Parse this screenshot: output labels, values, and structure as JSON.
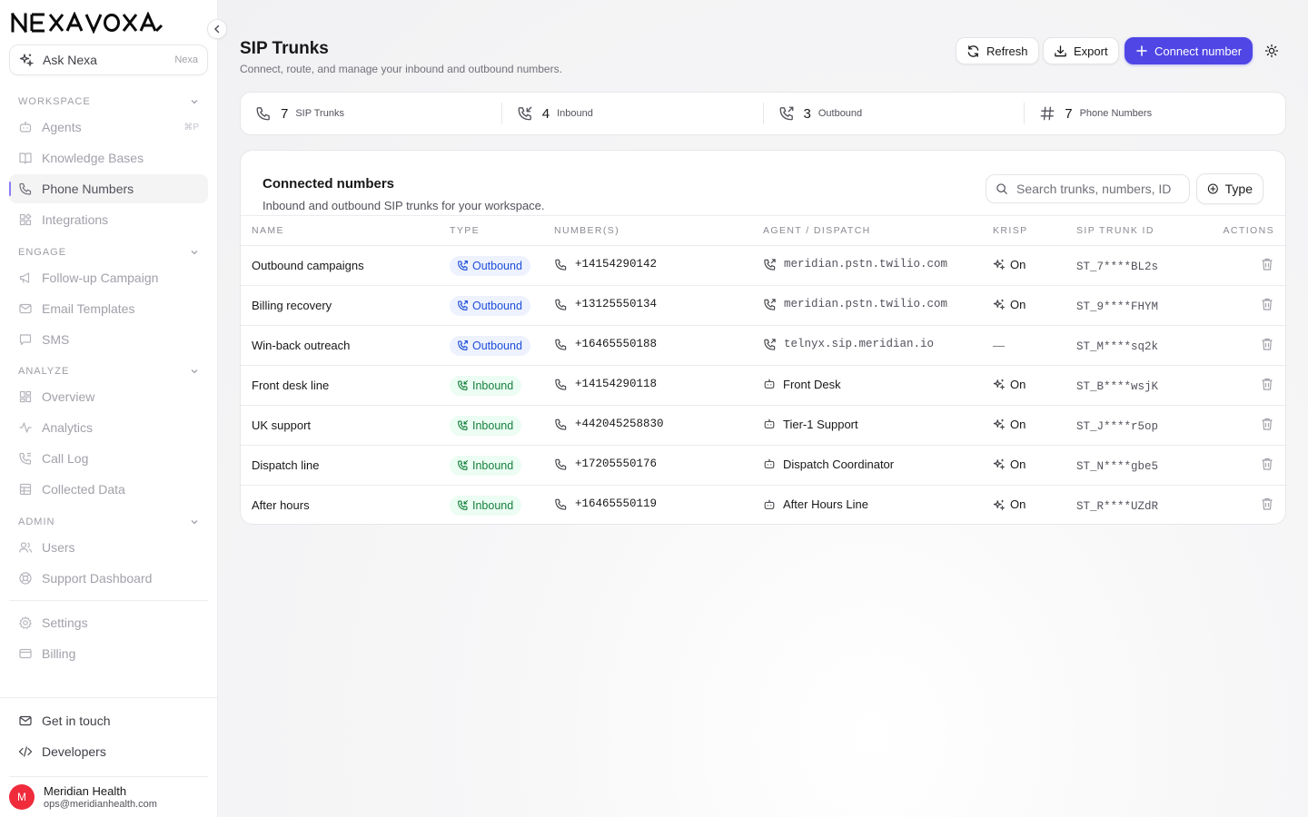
{
  "brand": {
    "name": "NEXAVOXA"
  },
  "sidebar": {
    "ask": {
      "label": "Ask Nexa",
      "hint": "Nexa"
    },
    "sections": [
      {
        "title": "WORKSPACE",
        "items": [
          {
            "label": "Agents",
            "shortcut": "⌘P",
            "icon": "robot-icon"
          },
          {
            "label": "Knowledge Bases",
            "icon": "book-icon"
          },
          {
            "label": "Phone Numbers",
            "icon": "phone-icon",
            "active": true
          },
          {
            "label": "Integrations",
            "icon": "puzzle-icon"
          }
        ]
      },
      {
        "title": "ENGAGE",
        "items": [
          {
            "label": "Follow-up Campaign",
            "icon": "megaphone-icon"
          },
          {
            "label": "Email Templates",
            "icon": "mail-icon"
          },
          {
            "label": "SMS",
            "icon": "chat-icon"
          }
        ]
      },
      {
        "title": "ANALYZE",
        "items": [
          {
            "label": "Overview",
            "icon": "dashboard-icon"
          },
          {
            "label": "Analytics",
            "icon": "activity-icon"
          },
          {
            "label": "Call Log",
            "icon": "phone-log-icon"
          },
          {
            "label": "Collected Data",
            "icon": "table-icon"
          }
        ]
      },
      {
        "title": "ADMIN",
        "items": [
          {
            "label": "Users",
            "icon": "users-icon"
          },
          {
            "label": "Support Dashboard",
            "icon": "lifebuoy-icon"
          }
        ]
      }
    ],
    "settings": "Settings",
    "billing": "Billing",
    "get_in_touch": "Get in touch",
    "developers": "Developers",
    "user": {
      "initial": "M",
      "name": "Meridian Health",
      "email": "ops@meridianhealth.com"
    }
  },
  "header": {
    "title": "SIP Trunks",
    "subtitle": "Connect, route, and manage your inbound and outbound numbers.",
    "refresh": "Refresh",
    "export": "Export",
    "connect": "Connect number"
  },
  "stats": [
    {
      "value": "7",
      "label": "SIP Trunks"
    },
    {
      "value": "4",
      "label": "Inbound"
    },
    {
      "value": "3",
      "label": "Outbound"
    },
    {
      "value": "7",
      "label": "Phone Numbers"
    }
  ],
  "card": {
    "title": "Connected numbers",
    "subtitle": "Inbound and outbound SIP trunks for your workspace.",
    "search_placeholder": "Search trunks, numbers, ID",
    "type_filter": "Type"
  },
  "table": {
    "columns": [
      "NAME",
      "TYPE",
      "NUMBER(S)",
      "AGENT / DISPATCH",
      "KRISP",
      "SIP TRUNK ID",
      "ACTIONS"
    ],
    "rows": [
      {
        "name": "Outbound campaigns",
        "type": "Outbound",
        "number": "+14154290142",
        "agent": "meridian.pstn.twilio.com",
        "agent_kind": "dispatch",
        "krisp": "On",
        "id": "ST_7****BL2s"
      },
      {
        "name": "Billing recovery",
        "type": "Outbound",
        "number": "+13125550134",
        "agent": "meridian.pstn.twilio.com",
        "agent_kind": "dispatch",
        "krisp": "On",
        "id": "ST_9****FHYM"
      },
      {
        "name": "Win-back outreach",
        "type": "Outbound",
        "number": "+16465550188",
        "agent": "telnyx.sip.meridian.io",
        "agent_kind": "dispatch",
        "krisp": "—",
        "id": "ST_M****sq2k"
      },
      {
        "name": "Front desk line",
        "type": "Inbound",
        "number": "+14154290118",
        "agent": "Front Desk",
        "agent_kind": "agent",
        "krisp": "On",
        "id": "ST_B****wsjK"
      },
      {
        "name": "UK support",
        "type": "Inbound",
        "number": "+442045258830",
        "agent": "Tier-1 Support",
        "agent_kind": "agent",
        "krisp": "On",
        "id": "ST_J****r5op"
      },
      {
        "name": "Dispatch line",
        "type": "Inbound",
        "number": "+17205550176",
        "agent": "Dispatch Coordinator",
        "agent_kind": "agent",
        "krisp": "On",
        "id": "ST_N****gbe5"
      },
      {
        "name": "After hours",
        "type": "Inbound",
        "number": "+16465550119",
        "agent": "After Hours Line",
        "agent_kind": "agent",
        "krisp": "On",
        "id": "ST_R****UZdR"
      }
    ]
  },
  "colors": {
    "primary": "#4f46e5",
    "outbound": "#1d4ed8",
    "inbound": "#15803d",
    "avatar": "#ef2b3c"
  }
}
